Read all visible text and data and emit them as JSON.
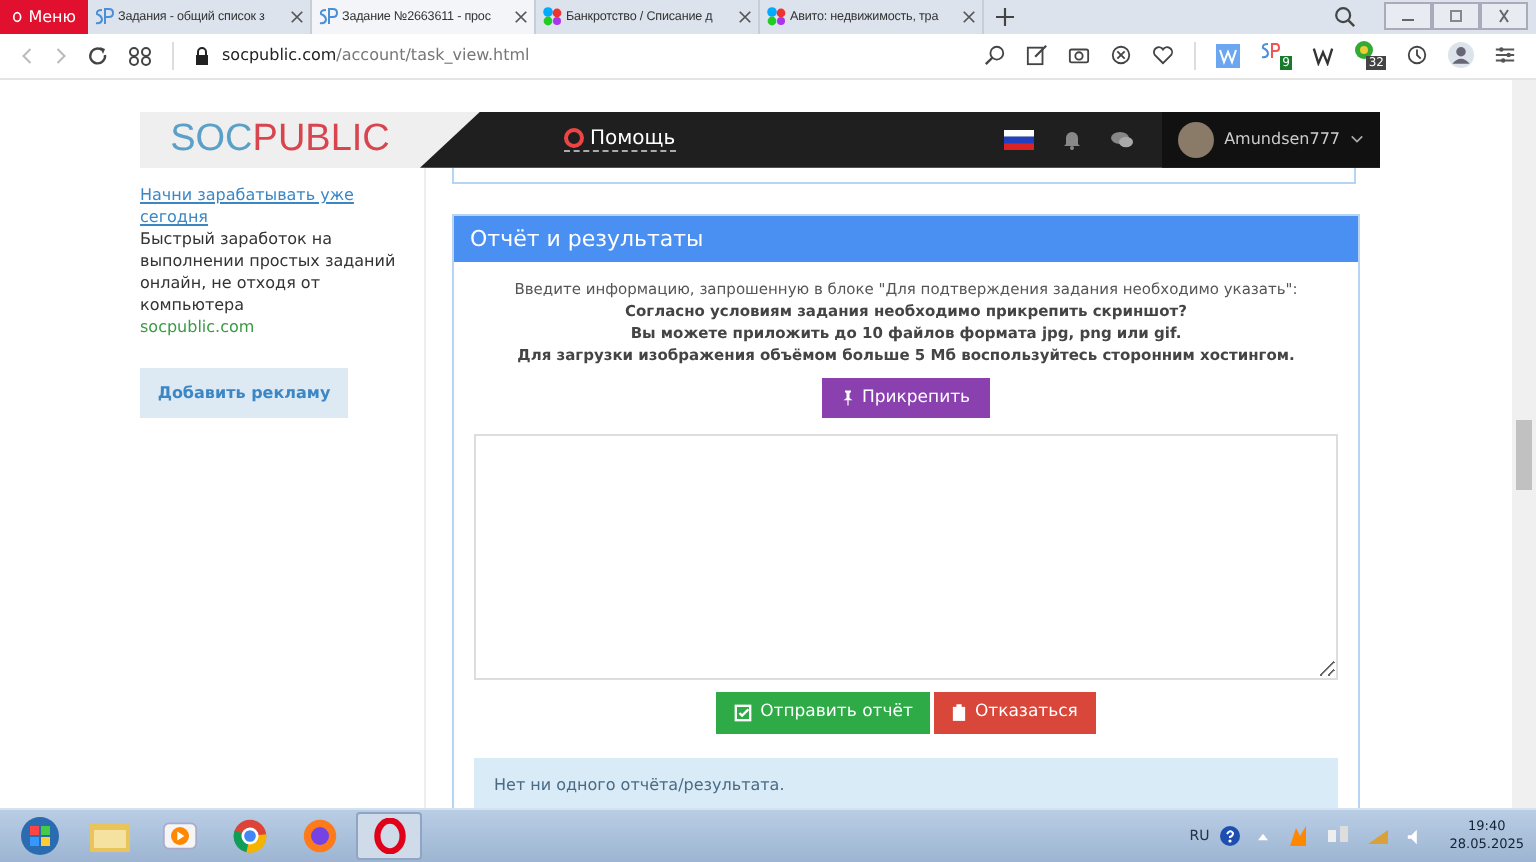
{
  "browser": {
    "menu_label": "Меню",
    "tabs": [
      {
        "title": "Задания - общий список з",
        "selected": false
      },
      {
        "title": "Задание №2663611 - прос",
        "selected": true
      },
      {
        "title": "Банкротство / Списание д",
        "selected": false
      },
      {
        "title": "Авито: недвижимость, тра",
        "selected": false
      }
    ],
    "url_host": "socpublic.com",
    "url_path": "/account/task_view.html",
    "extension_badges": [
      "9",
      "32"
    ]
  },
  "header": {
    "logo_first": "SOC",
    "logo_second": "PUBLIC",
    "help": "Помощь",
    "username": "Amundsen777"
  },
  "sidebar": {
    "link": "Начни зарабатывать уже сегодня",
    "text": "Быстрый заработок на выполнении простых заданий онлайн, не отходя от компьютера",
    "site": "socpublic.com",
    "button": "Добавить рекламу"
  },
  "panel": {
    "title": "Отчёт и результаты",
    "lines": [
      {
        "text": "Введите информацию, запрошенную в блоке \"Для подтверждения задания необходимо указать\":",
        "bold": false
      },
      {
        "text": "Согласно условиям задания необходимо прикрепить скриншот?",
        "bold": true
      },
      {
        "text": "Вы можете приложить до 10 файлов формата jpg, png или gif.",
        "bold": true
      },
      {
        "text": "Для загрузки изображения объёмом больше 5 Мб воспользуйтесь сторонним хостингом.",
        "bold": true
      }
    ],
    "attach_button": "Прикрепить",
    "submit_button": "Отправить отчёт",
    "refuse_button": "Отказаться",
    "info": "Нет ни одного отчёта/результата."
  },
  "taskbar": {
    "apps": [
      {
        "kind": "folder",
        "selected": false
      },
      {
        "kind": "media",
        "selected": false
      },
      {
        "kind": "chrome",
        "selected": false
      },
      {
        "kind": "firefox",
        "selected": false
      },
      {
        "kind": "opera",
        "selected": true
      }
    ],
    "language": "RU",
    "time": "19:40",
    "date": "28.05.2025"
  }
}
